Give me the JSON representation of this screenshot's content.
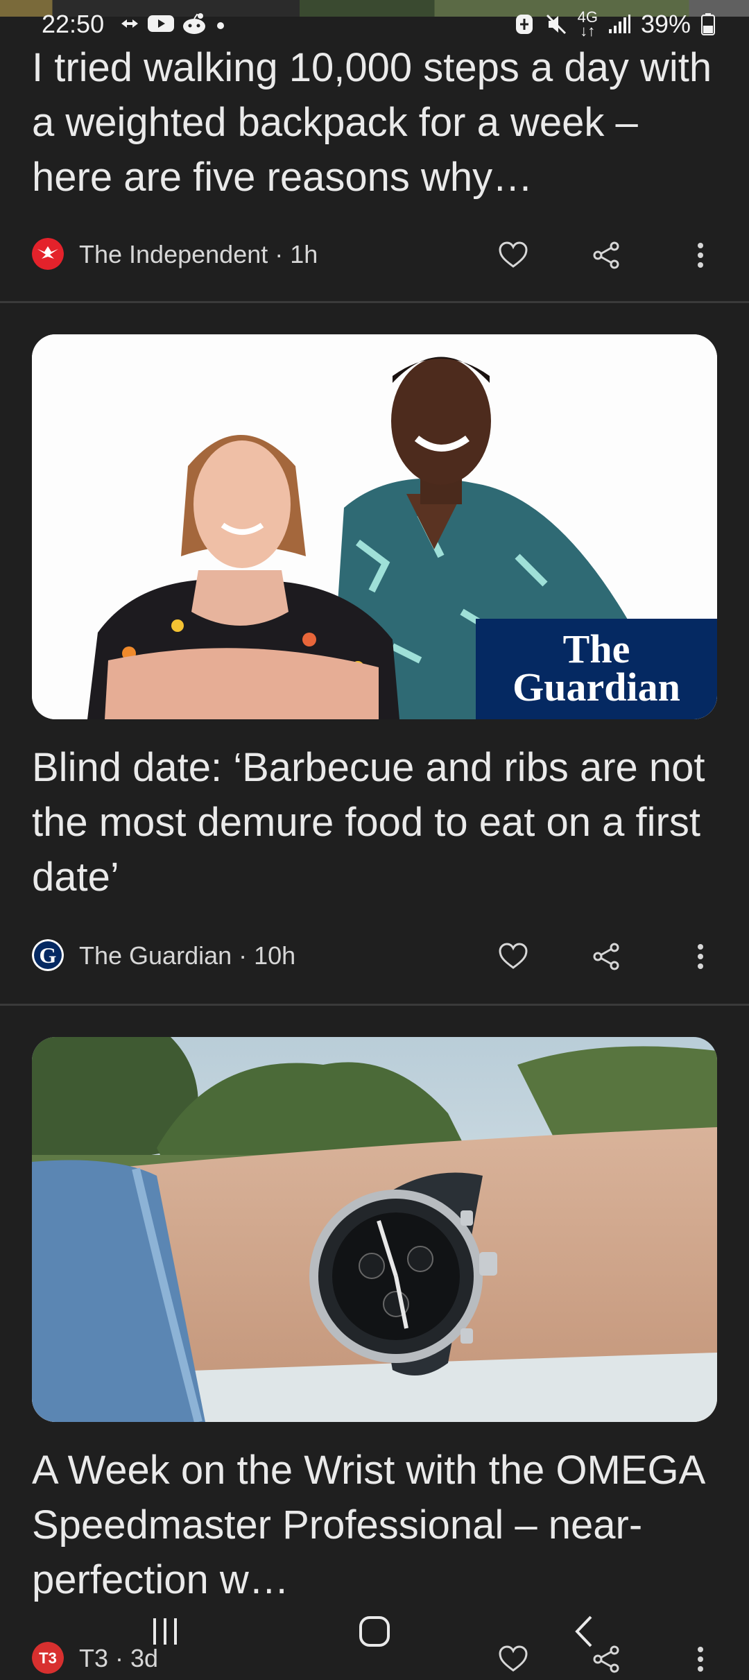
{
  "status_bar": {
    "time": "22:50",
    "battery": "39%",
    "network": "4G",
    "icons_left": [
      "cast-icon",
      "youtube-icon",
      "reddit-icon",
      "dot-icon"
    ],
    "icons_right": [
      "battery-saver-icon",
      "mute-icon",
      "network-4g-icon",
      "signal-icon",
      "battery-icon"
    ]
  },
  "articles": [
    {
      "title": "I tried walking 10,000 steps a day with a weighted backpack for a week – here are five reasons why…",
      "source": "The Independent · 1h",
      "source_logo": "independent-eagle-logo"
    },
    {
      "title": "Blind date: ‘Barbecue and ribs are not the most demure food to eat on a first date’",
      "source": "The Guardian · 10h",
      "source_logo": "guardian-g-logo",
      "image_watermark_line1": "The",
      "image_watermark_line2": "Guardian"
    },
    {
      "title": "A Week on the Wrist with the OMEGA Speedmaster Professional – near-perfection w…",
      "source": "T3 · 3d",
      "source_logo": "t3-logo"
    }
  ],
  "actions": {
    "like": "heart-icon",
    "share": "share-icon",
    "more": "more-vert-icon"
  },
  "colors": {
    "background": "#1f1f1f",
    "text": "#eaeaea",
    "divider": "#3a3a3a",
    "guardian_blue": "#052962",
    "independent_red": "#e4222b"
  }
}
